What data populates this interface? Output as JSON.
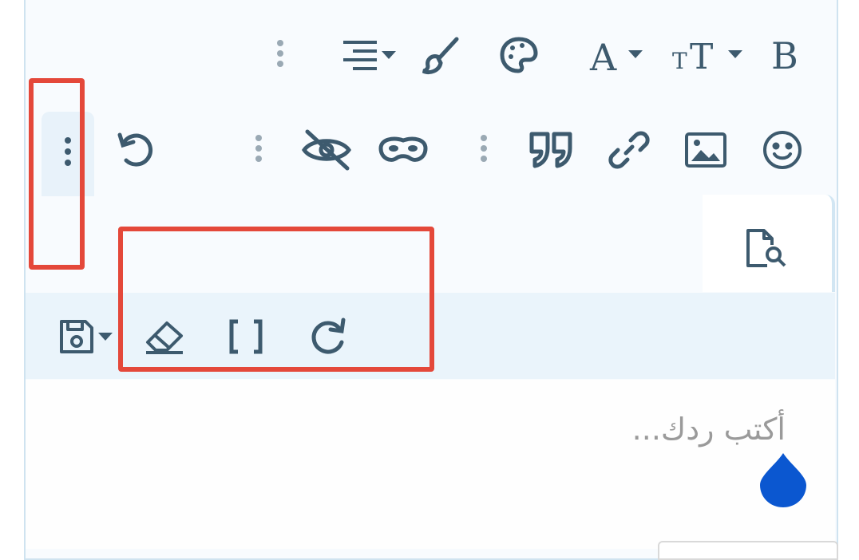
{
  "toolbar_row1": {
    "icons": [
      "bold-icon",
      "text-size-icon",
      "font-color-icon",
      "palette-icon",
      "brush-icon",
      "align-icon",
      "more-vertical-icon"
    ]
  },
  "toolbar_row2": {
    "icons": [
      "emoji-icon",
      "image-icon",
      "link-icon",
      "quote-icon",
      "more-vertical-icon",
      "spoiler-mask-icon",
      "hide-eye-icon",
      "more-vertical-icon",
      "undo-icon",
      "more-vertical-icon"
    ]
  },
  "toolbar_row3": {
    "icons": [
      "preview-icon",
      "save-draft-icon",
      "eraser-icon",
      "brackets-icon",
      "redo-icon"
    ]
  },
  "editor": {
    "placeholder": "أكتب ردك..."
  },
  "colors": {
    "icon": "#3d5a6e",
    "highlight": "#e4483a",
    "drop": "#0b57d0",
    "band": "#eaf4fb"
  }
}
